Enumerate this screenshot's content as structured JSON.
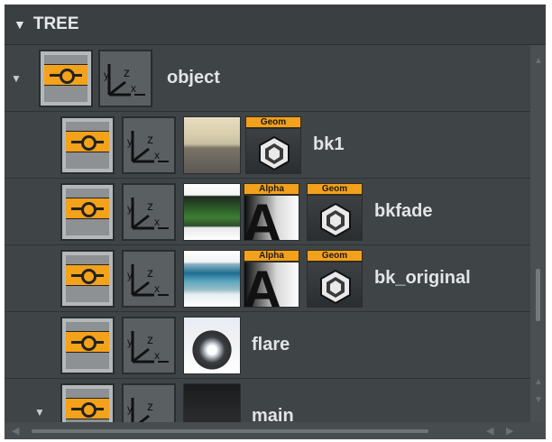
{
  "header": {
    "collapse_icon": "triangle-down-icon",
    "title": "TREE"
  },
  "tree": {
    "rows": [
      {
        "name": "object",
        "thumb": null,
        "tags": []
      },
      {
        "name": "bk1",
        "thumb": "sky",
        "tags": [
          "Geom"
        ]
      },
      {
        "name": "bkfade",
        "thumb": "field",
        "tags": [
          "Alpha",
          "Geom"
        ]
      },
      {
        "name": "bk_original",
        "thumb": "studio",
        "tags": [
          "Alpha",
          "Geom"
        ]
      },
      {
        "name": "flare",
        "thumb": "flare",
        "tags": []
      },
      {
        "name": "main",
        "thumb": "dark",
        "tags": []
      }
    ],
    "axis_letters": {
      "y": "y",
      "z": "z",
      "x": "x"
    }
  },
  "colors": {
    "accent": "#f3a21a",
    "panel": "#3d4245",
    "text": "#e2e4e5"
  }
}
